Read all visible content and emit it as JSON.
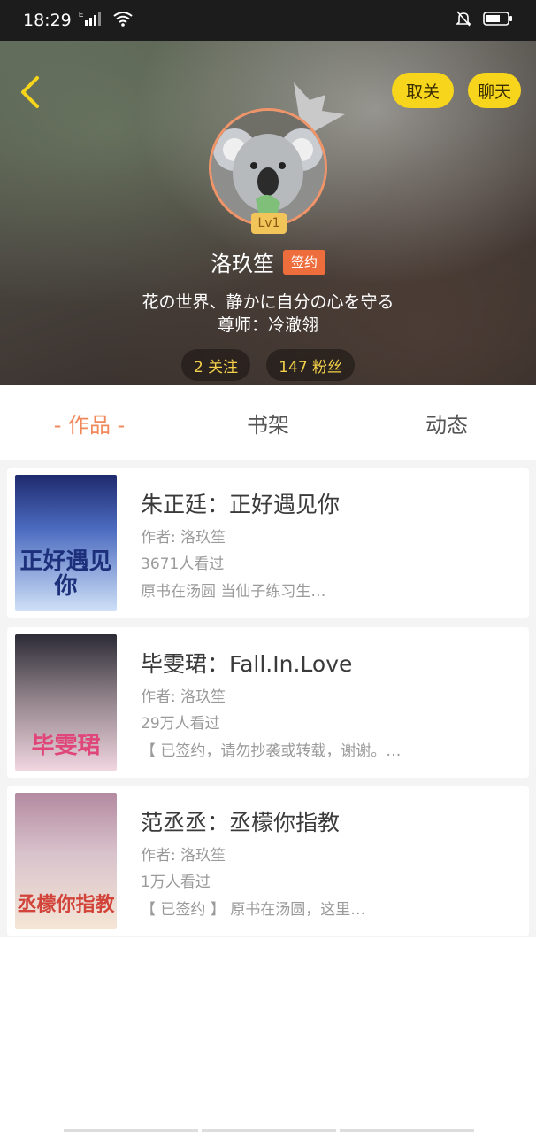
{
  "status": {
    "time": "18:29",
    "network": "E",
    "icons": [
      "signal-icon",
      "wifi-icon",
      "mute-icon",
      "battery-icon"
    ]
  },
  "header": {
    "buttons": {
      "unfollow": "取关",
      "chat": "聊天"
    },
    "level": "Lv1",
    "name": "洛玖笙",
    "badge": "签约",
    "bio_line1": "花の世界、静かに自分の心を守る",
    "bio_line2": "尊师：冷澈翎",
    "stats": {
      "following": "2 关注",
      "fans": "147 粉丝"
    }
  },
  "tabs": [
    {
      "label": "- 作品 -",
      "active": true
    },
    {
      "label": "书架",
      "active": false
    },
    {
      "label": "动态",
      "active": false
    }
  ],
  "works": [
    {
      "title": "朱正廷：正好遇见你",
      "author": "作者: 洛玖笙",
      "views": "3671人看过",
      "desc": "原书在汤圆 当仙子练习生…",
      "cover_text": "正好遇见你",
      "cover_colors": [
        "#2a3a8a",
        "#8fb3e6"
      ]
    },
    {
      "title": "毕雯珺：Fall.In.Love",
      "author": "作者: 洛玖笙",
      "views": "29万人看过",
      "desc": "【 已签约，请勿抄袭或转载，谢谢。…",
      "cover_text": "毕雯珺",
      "cover_colors": [
        "#3a3a4a",
        "#e9b7c9"
      ]
    },
    {
      "title": "范丞丞：丞檬你指教",
      "author": "作者: 洛玖笙",
      "views": "1万人看过",
      "desc": "【 已签约 】 原书在汤圆，这里…",
      "cover_text": "丞檬你指教",
      "cover_colors": [
        "#c4a6b4",
        "#f0d9c2"
      ]
    }
  ],
  "colors": {
    "accent": "#f0885a",
    "yellow": "#f7d51d",
    "signed": "#ee6d3c"
  }
}
